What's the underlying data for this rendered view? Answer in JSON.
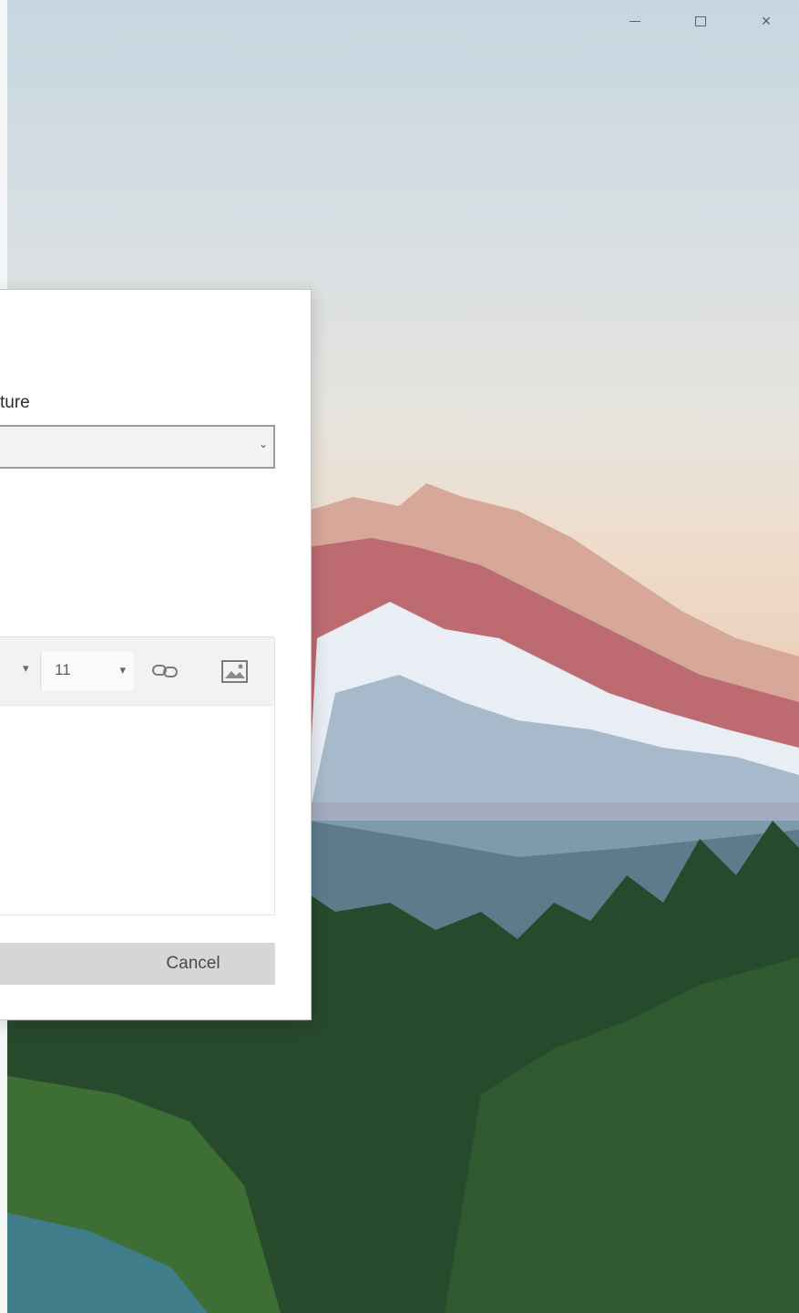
{
  "window": {
    "minimize_icon": "minimize-icon",
    "maximize_icon": "maximize-icon",
    "close_label": "×"
  },
  "dialog": {
    "field_label": "ture",
    "combo_value": "",
    "combo_arrow": "⌄",
    "toolbar": {
      "font_arrow": "▾",
      "font_size": "11",
      "size_arrow": "▾",
      "link_icon": "link-icon",
      "image_icon": "insert-image-icon"
    },
    "editor_content": "",
    "cancel_label": "Cancel"
  },
  "colors": {
    "dialog_bg": "#ffffff",
    "button_bg": "#d6d6d6",
    "toolbar_bg": "#f2f2f2"
  }
}
